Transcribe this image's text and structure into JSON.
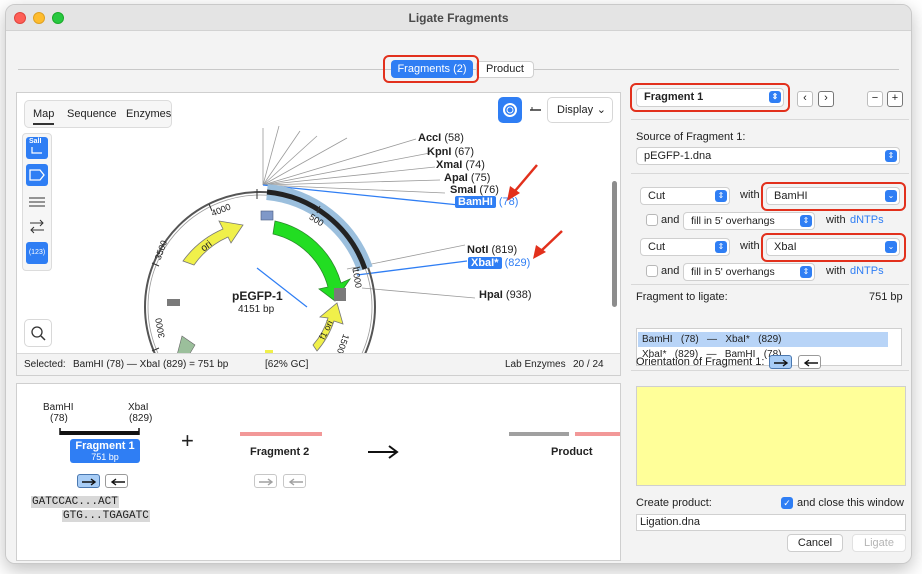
{
  "window": {
    "title": "Ligate Fragments"
  },
  "tabs": [
    {
      "label": "Fragments (2)"
    },
    {
      "label": "Product"
    }
  ],
  "map_panel": {
    "view_tabs": [
      "Map",
      "Sequence",
      "Enzymes"
    ],
    "display_label": "Display",
    "plasmid_name": "pEGFP-1",
    "plasmid_size": "4151 bp",
    "tool_labels": {
      "sall": "SalI",
      "numbers": "(123)"
    },
    "sites": [
      {
        "name": "AccI",
        "pos": "(58)"
      },
      {
        "name": "KpnI",
        "pos": "(67)"
      },
      {
        "name": "XmaI",
        "pos": "(74)"
      },
      {
        "name": "ApaI",
        "pos": "(75)"
      },
      {
        "name": "SmaI",
        "pos": "(76)"
      },
      {
        "name": "BamHI",
        "pos": "(78)"
      },
      {
        "name": "NotI",
        "pos": "(819)"
      },
      {
        "name": "XbaI*",
        "pos": "(829)"
      },
      {
        "name": "HpaI",
        "pos": "(938)"
      }
    ],
    "ticks": [
      "500",
      "1000",
      "1500",
      "3000",
      "3500",
      "4000"
    ],
    "features": [
      "ori",
      "f1 ori"
    ],
    "status": {
      "selected_label": "Selected:",
      "selection": "BamHI (78)  —  XbaI (829)  =  751 bp",
      "gc": "[62% GC]",
      "enzymes": "Lab Enzymes",
      "count": "20 / 24"
    }
  },
  "ligation_panel": {
    "left_site": {
      "name": "BamHI",
      "pos": "(78)"
    },
    "right_site": {
      "name": "XbaI",
      "pos": "(829)"
    },
    "fragment1": {
      "title": "Fragment 1",
      "size": "751 bp"
    },
    "plus": "+",
    "fragment2": {
      "title": "Fragment 2"
    },
    "product": {
      "title": "Product"
    },
    "seq_top": "GATCCAC...ACT",
    "seq_bottom": "GTG...TGAGATC"
  },
  "right_panel": {
    "fragment_select": "Fragment 1",
    "source_label": "Source of Fragment 1:",
    "source_value": "pEGFP-1.dna",
    "cut1": {
      "action": "Cut",
      "with": "with",
      "enzyme": "BamHI",
      "and": "and",
      "fill": "fill in 5' overhangs",
      "with2": "with",
      "dntps": "dNTPs"
    },
    "cut2": {
      "action": "Cut",
      "with": "with",
      "enzyme": "XbaI",
      "and": "and",
      "fill": "fill in 5' overhangs",
      "with2": "with",
      "dntps": "dNTPs"
    },
    "fragment_to_ligate_label": "Fragment to ligate:",
    "fragment_size": "751 bp",
    "list_rows": [
      "BamHI   (78)   —   XbaI*   (829)",
      "XbaI*   (829)   —   BamHI   (78)"
    ],
    "orientation_label": "Orientation of Fragment 1:",
    "create_product_label": "Create product:",
    "close_window_label": "and close this window",
    "product_name": "Ligation.dna",
    "cancel": "Cancel",
    "ligate": "Ligate"
  },
  "colors": {
    "accent": "#2f7ef4",
    "highlight": "#e2301c",
    "ori_yellow": "#f0f04a",
    "gfp_green": "#22dd22",
    "notes_yellow": "#ffff99"
  }
}
